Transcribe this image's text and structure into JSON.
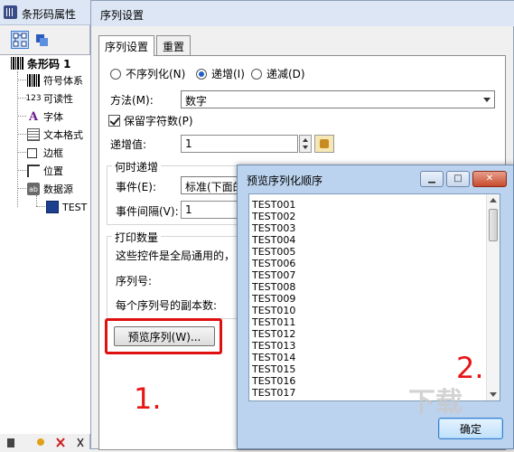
{
  "left_window": {
    "title": "条形码属性",
    "tree": [
      {
        "label": "条形码 1",
        "icon": "barcode-icon"
      },
      {
        "label": "符号体系",
        "icon": "barcode-symbology-icon"
      },
      {
        "label": "可读性",
        "icon": "readable-123-icon",
        "icon_text": "123"
      },
      {
        "label": "字体",
        "icon": "font-icon",
        "icon_text": "A"
      },
      {
        "label": "文本格式",
        "icon": "text-format-icon"
      },
      {
        "label": "边框",
        "icon": "border-icon"
      },
      {
        "label": "位置",
        "icon": "position-icon"
      },
      {
        "label": "数据源",
        "icon": "datasource-icon",
        "icon_text": "ab"
      },
      {
        "label": "TEST",
        "icon": "data-item-icon"
      }
    ]
  },
  "dialog": {
    "title": "序列设置",
    "tabs": [
      {
        "label": "序列设置",
        "active": true
      },
      {
        "label": "重置",
        "active": false
      }
    ],
    "radios": [
      {
        "label": "不序列化(N)",
        "selected": false
      },
      {
        "label": "递增(I)",
        "selected": true
      },
      {
        "label": "递减(D)",
        "selected": false
      }
    ],
    "method_label": "方法(M):",
    "method_value": "数字",
    "keep_chars_label": "保留字符数(P)",
    "keep_chars_checked": true,
    "increment_label": "递增值:",
    "increment_value": "1",
    "when_group_title": "何时递增",
    "event_label": "事件(E):",
    "event_value": "标准(下面的",
    "event_interval_label": "事件间隔(V):",
    "event_interval_value": "1",
    "print_group_title": "打印数量",
    "print_note": "这些控件是全局通用的，",
    "serial_label": "序列号:",
    "copies_label": "每个序列号的副本数:",
    "preview_button": "预览序列(W)..."
  },
  "popup": {
    "title": "预览序列化顺序",
    "items": [
      "TEST001",
      "TEST002",
      "TEST003",
      "TEST004",
      "TEST005",
      "TEST006",
      "TEST007",
      "TEST008",
      "TEST009",
      "TEST010",
      "TEST011",
      "TEST012",
      "TEST013",
      "TEST014",
      "TEST015",
      "TEST016",
      "TEST017"
    ],
    "ok_button": "确定"
  },
  "annotations": {
    "step1": "1.",
    "step2": "2.",
    "color": "#e01010"
  }
}
